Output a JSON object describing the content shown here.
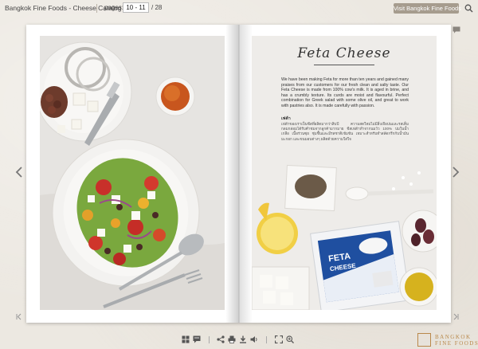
{
  "header": {
    "title": "Bangkok Fine Foods - Cheese Catalog",
    "pages_label": "pages:",
    "page_input_value": "10 - 11",
    "page_total": "/  28",
    "visit_button_label": "Visit Bangkok Fine Foods",
    "search_icon": "search-icon"
  },
  "right_page": {
    "heading": "Feta Cheese",
    "body_en": "We have been making Feta for more than ten years and gained many praises from our customers for our fresh clean and salty taste. Our Feta Cheese is made from 100% cow's milk. It is aged in brine, and has a crumbly texture. Its curds are moist and flavourful. Perfect combination for Greek salad with some olive oil, and great to work with pastries also. It is made carefully with passion.",
    "thai_label": "เฟต้า",
    "body_th": "เฟต้าของเราเป็นชีสที่ผลิตมากว่าสิบปี ความสดใหม่ไม่มีสิ่งเจือปนและรสเค็มกลมกล่อมได้รับคำชมจากลูกค้ามากมาย ชีสเฟต้าทำจากนมวัว 100% บ่มในน้ำเกลือ เนื้อร่วนซุย ชุ่มชื้นและมีรสชาติเข้มข้น เหมาะสำหรับทำสลัดกรีกกับน้ำมันมะกอก และขนมอบต่างๆ ผลิตด้วยความใส่ใจ",
    "package_brand": "FETA",
    "package_sub": "CHEESE"
  },
  "navigation": {
    "prev_icon": "chevron-left-icon",
    "next_icon": "chevron-right-icon",
    "first_icon": "double-chevron-left-icon",
    "last_icon": "double-chevron-right-icon"
  },
  "toolbar": {
    "icons": [
      "thumbnails-icon",
      "comment-icon",
      "share-icon",
      "print-icon",
      "download-icon",
      "sound-icon",
      "fullscreen-icon",
      "zoom-in-icon"
    ]
  },
  "logo": {
    "line1": "BANGKOK",
    "line2": "FINE FOODS"
  },
  "colors": {
    "accent": "#a69c8e",
    "logo": "#b9884a",
    "background": "#ece8e1"
  }
}
